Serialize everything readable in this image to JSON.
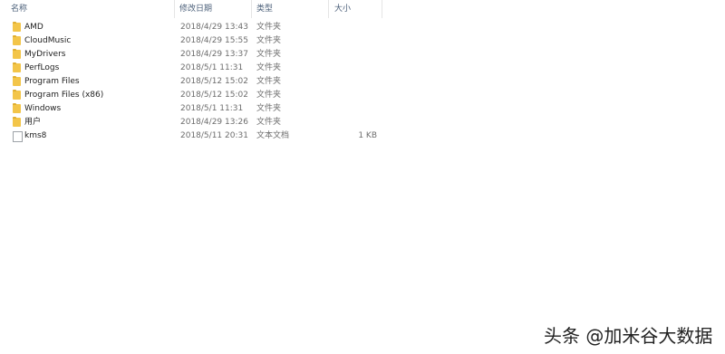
{
  "header": {
    "columns": [
      {
        "label": "名称"
      },
      {
        "label": "修改日期"
      },
      {
        "label": "类型"
      },
      {
        "label": "大小"
      }
    ],
    "sort_arrow": "^"
  },
  "files": [
    {
      "name": "AMD",
      "date": "2018/4/29 13:43",
      "type": "文件夹",
      "size": "",
      "icon": "folder-icon"
    },
    {
      "name": "CloudMusic",
      "date": "2018/4/29 15:55",
      "type": "文件夹",
      "size": "",
      "icon": "folder-icon"
    },
    {
      "name": "MyDrivers",
      "date": "2018/4/29 13:37",
      "type": "文件夹",
      "size": "",
      "icon": "folder-icon"
    },
    {
      "name": "PerfLogs",
      "date": "2018/5/1 11:31",
      "type": "文件夹",
      "size": "",
      "icon": "folder-icon"
    },
    {
      "name": "Program Files",
      "date": "2018/5/12 15:02",
      "type": "文件夹",
      "size": "",
      "icon": "folder-icon"
    },
    {
      "name": "Program Files (x86)",
      "date": "2018/5/12 15:02",
      "type": "文件夹",
      "size": "",
      "icon": "folder-icon"
    },
    {
      "name": "Windows",
      "date": "2018/5/1 11:31",
      "type": "文件夹",
      "size": "",
      "icon": "folder-icon"
    },
    {
      "name": "用户",
      "date": "2018/4/29 13:26",
      "type": "文件夹",
      "size": "",
      "icon": "folder-icon"
    },
    {
      "name": "kms8",
      "date": "2018/5/11 20:31",
      "type": "文本文档",
      "size": "1 KB",
      "icon": "text-file-icon"
    }
  ],
  "watermark": "头条 @加米谷大数据",
  "colors": {
    "folder": "#f3c549",
    "header_text": "#4c607a",
    "meta_text": "#6d6d6d"
  }
}
